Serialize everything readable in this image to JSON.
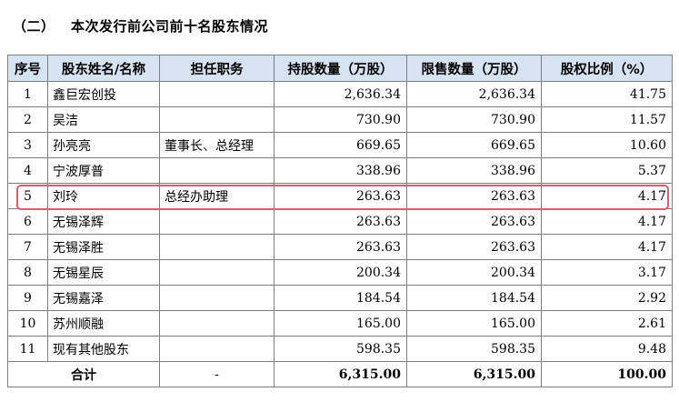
{
  "section": {
    "number": "（二）",
    "title": "本次发行前公司前十名股东情况"
  },
  "table": {
    "headers": [
      "序号",
      "股东姓名/名称",
      "担任职务",
      "持股数量（万股）",
      "限售数量（万股）",
      "股权比例（%）"
    ],
    "rows": [
      {
        "idx": "1",
        "name": "鑫巨宏创投",
        "role": "",
        "shares": "2,636.34",
        "restricted": "2,636.34",
        "ratio": "41.75"
      },
      {
        "idx": "2",
        "name": "吴洁",
        "role": "",
        "shares": "730.90",
        "restricted": "730.90",
        "ratio": "11.57"
      },
      {
        "idx": "3",
        "name": "孙亮亮",
        "role": "董事长、总经理",
        "shares": "669.65",
        "restricted": "669.65",
        "ratio": "10.60"
      },
      {
        "idx": "4",
        "name": "宁波厚普",
        "role": "",
        "shares": "338.96",
        "restricted": "338.96",
        "ratio": "5.37"
      },
      {
        "idx": "5",
        "name": "刘玲",
        "role": "总经办助理",
        "shares": "263.63",
        "restricted": "263.63",
        "ratio": "4.17"
      },
      {
        "idx": "6",
        "name": "无锡泽辉",
        "role": "",
        "shares": "263.63",
        "restricted": "263.63",
        "ratio": "4.17"
      },
      {
        "idx": "7",
        "name": "无锡泽胜",
        "role": "",
        "shares": "263.63",
        "restricted": "263.63",
        "ratio": "4.17"
      },
      {
        "idx": "8",
        "name": "无锡星辰",
        "role": "",
        "shares": "200.34",
        "restricted": "200.34",
        "ratio": "3.17"
      },
      {
        "idx": "9",
        "name": "无锡嘉泽",
        "role": "",
        "shares": "184.54",
        "restricted": "184.54",
        "ratio": "2.92"
      },
      {
        "idx": "10",
        "name": "苏州顺融",
        "role": "",
        "shares": "165.00",
        "restricted": "165.00",
        "ratio": "2.61"
      },
      {
        "idx": "11",
        "name": "现有其他股东",
        "role": "",
        "shares": "598.35",
        "restricted": "598.35",
        "ratio": "9.48"
      }
    ],
    "total": {
      "label": "合计",
      "role": "-",
      "shares": "6,315.00",
      "restricted": "6,315.00",
      "ratio": "100.00"
    }
  },
  "highlight": {
    "row_index": 5,
    "color": "#e25a70"
  },
  "colors": {
    "header_bg": "#d6e3f3",
    "border": "#7f7f7f"
  }
}
